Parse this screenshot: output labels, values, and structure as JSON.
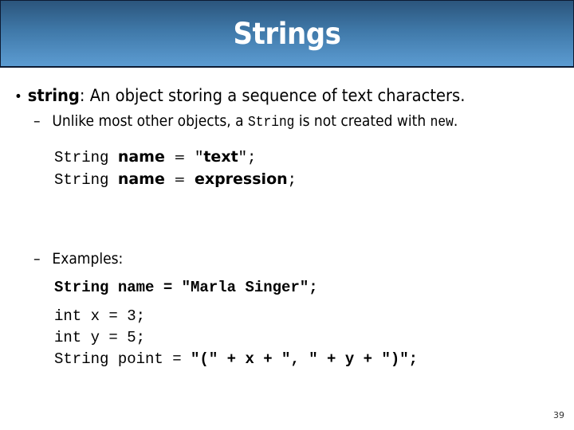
{
  "slide": {
    "title": "Strings",
    "page_number": "39",
    "bullet": {
      "term": "string",
      "definition": ": An object storing a sequence of text characters."
    },
    "sub_bullet_1": {
      "prefix": "Unlike most other objects, a ",
      "code1": "String",
      "middle": " is not created with ",
      "code2": "new",
      "suffix": "."
    },
    "syntax": [
      {
        "type": "String",
        "name": "name",
        "eq": "=",
        "q1": "\"",
        "value": "text",
        "q2": "\";"
      },
      {
        "type": "String",
        "name": "name",
        "eq": "=",
        "value": "expression",
        "end": ";"
      }
    ],
    "sub_bullet_2": "Examples:",
    "examples": {
      "line1": "String name = \"Marla Singer\";",
      "line2": "int x = 3;",
      "line3": "int y = 5;",
      "line4_plain": "String point = ",
      "line4_bold": "\"(\" + x + \", \" + y + \")\";"
    }
  }
}
